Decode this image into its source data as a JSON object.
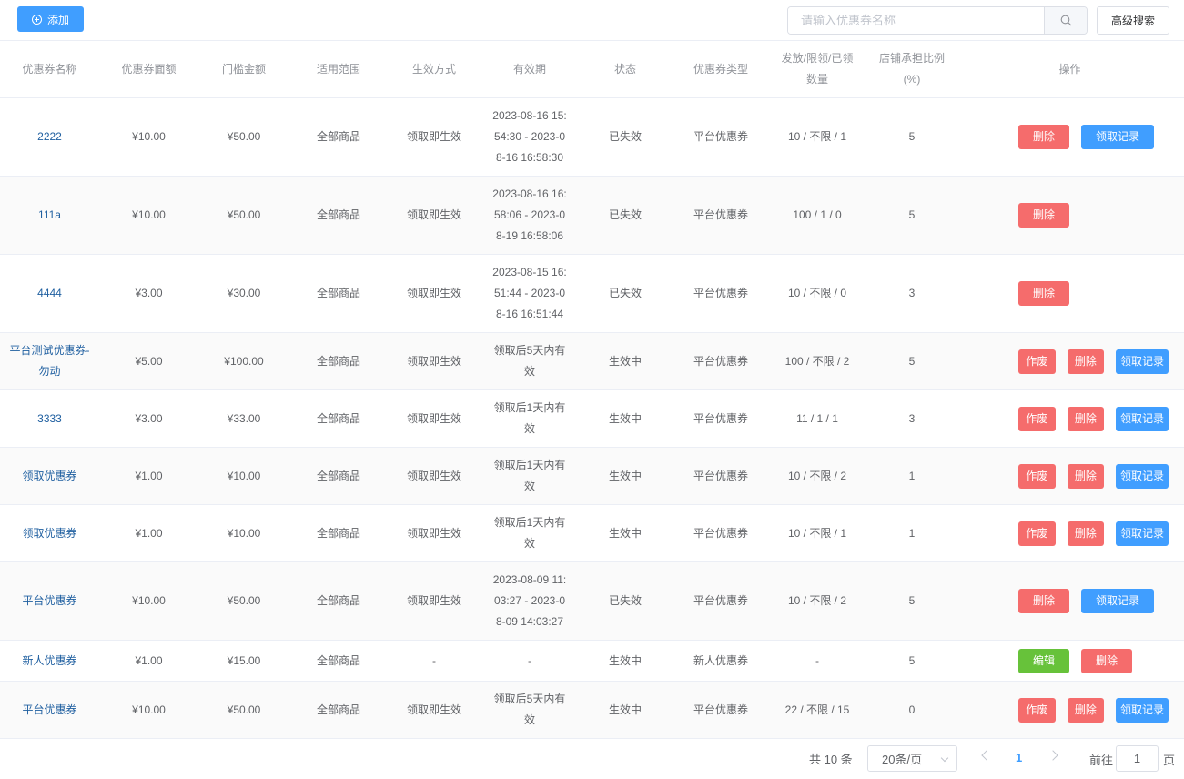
{
  "toolbar": {
    "add_label": "添加",
    "search_placeholder": "请输入优惠券名称",
    "advanced_search_label": "高级搜索"
  },
  "table": {
    "headers": {
      "name": "优惠券名称",
      "amount": "优惠券面额",
      "threshold": "门槛金额",
      "scope": "适用范围",
      "effect_mode": "生效方式",
      "validity": "有效期",
      "status": "状态",
      "type": "优惠券类型",
      "quantity_l1": "发放/限领/已领",
      "quantity_l2": "数量",
      "ratio_l1": "店铺承担比例",
      "ratio_l2": "(%)",
      "ops": "操作"
    },
    "rows": [
      {
        "name": "2222",
        "amount": "¥10.00",
        "threshold": "¥50.00",
        "scope": "全部商品",
        "effect_mode": "领取即生效",
        "validity": [
          "2023-08-16 15:",
          "54:30 - 2023-0",
          "8-16 16:58:30"
        ],
        "status": "已失效",
        "type": "平台优惠券",
        "quantity": "10 / 不限 / 1",
        "ratio": "5",
        "ops": [
          {
            "label": "删除",
            "kind": "red"
          },
          {
            "label": "领取记录",
            "kind": "blue"
          }
        ]
      },
      {
        "name": "111a",
        "amount": "¥10.00",
        "threshold": "¥50.00",
        "scope": "全部商品",
        "effect_mode": "领取即生效",
        "validity": [
          "2023-08-16 16:",
          "58:06 - 2023-0",
          "8-19 16:58:06"
        ],
        "status": "已失效",
        "type": "平台优惠券",
        "quantity": "100 / 1 / 0",
        "ratio": "5",
        "ops": [
          {
            "label": "删除",
            "kind": "red"
          }
        ]
      },
      {
        "name": "4444",
        "amount": "¥3.00",
        "threshold": "¥30.00",
        "scope": "全部商品",
        "effect_mode": "领取即生效",
        "validity": [
          "2023-08-15 16:",
          "51:44 - 2023-0",
          "8-16 16:51:44"
        ],
        "status": "已失效",
        "type": "平台优惠券",
        "quantity": "10 / 不限 / 0",
        "ratio": "3",
        "ops": [
          {
            "label": "删除",
            "kind": "red"
          }
        ]
      },
      {
        "name": [
          "平台测试优惠券-",
          "勿动"
        ],
        "amount": "¥5.00",
        "threshold": "¥100.00",
        "scope": "全部商品",
        "effect_mode": "领取即生效",
        "validity": [
          "领取后5天内有",
          "效"
        ],
        "status": "生效中",
        "type": "平台优惠券",
        "quantity": "100 / 不限 / 2",
        "ratio": "5",
        "ops": [
          {
            "label": "作废",
            "kind": "red"
          },
          {
            "label": "删除",
            "kind": "red"
          },
          {
            "label": "领取记录",
            "kind": "blue"
          }
        ]
      },
      {
        "name": "3333",
        "amount": "¥3.00",
        "threshold": "¥33.00",
        "scope": "全部商品",
        "effect_mode": "领取即生效",
        "validity": [
          "领取后1天内有",
          "效"
        ],
        "status": "生效中",
        "type": "平台优惠券",
        "quantity": "11 / 1 / 1",
        "ratio": "3",
        "ops": [
          {
            "label": "作废",
            "kind": "red"
          },
          {
            "label": "删除",
            "kind": "red"
          },
          {
            "label": "领取记录",
            "kind": "blue"
          }
        ]
      },
      {
        "name": "领取优惠券",
        "amount": "¥1.00",
        "threshold": "¥10.00",
        "scope": "全部商品",
        "effect_mode": "领取即生效",
        "validity": [
          "领取后1天内有",
          "效"
        ],
        "status": "生效中",
        "type": "平台优惠券",
        "quantity": "10 / 不限 / 2",
        "ratio": "1",
        "ops": [
          {
            "label": "作废",
            "kind": "red"
          },
          {
            "label": "删除",
            "kind": "red"
          },
          {
            "label": "领取记录",
            "kind": "blue"
          }
        ]
      },
      {
        "name": "领取优惠券",
        "amount": "¥1.00",
        "threshold": "¥10.00",
        "scope": "全部商品",
        "effect_mode": "领取即生效",
        "validity": [
          "领取后1天内有",
          "效"
        ],
        "status": "生效中",
        "type": "平台优惠券",
        "quantity": "10 / 不限 / 1",
        "ratio": "1",
        "ops": [
          {
            "label": "作废",
            "kind": "red"
          },
          {
            "label": "删除",
            "kind": "red"
          },
          {
            "label": "领取记录",
            "kind": "blue"
          }
        ]
      },
      {
        "name": "平台优惠券",
        "amount": "¥10.00",
        "threshold": "¥50.00",
        "scope": "全部商品",
        "effect_mode": "领取即生效",
        "validity": [
          "2023-08-09 11:",
          "03:27 - 2023-0",
          "8-09 14:03:27"
        ],
        "status": "已失效",
        "type": "平台优惠券",
        "quantity": "10 / 不限 / 2",
        "ratio": "5",
        "ops": [
          {
            "label": "删除",
            "kind": "red"
          },
          {
            "label": "领取记录",
            "kind": "blue"
          }
        ]
      },
      {
        "name": "新人优惠券",
        "amount": "¥1.00",
        "threshold": "¥15.00",
        "scope": "全部商品",
        "effect_mode": "-",
        "validity": [
          "-"
        ],
        "status": "生效中",
        "type": "新人优惠券",
        "quantity": "-",
        "ratio": "5",
        "ops": [
          {
            "label": "编辑",
            "kind": "green"
          },
          {
            "label": "删除",
            "kind": "red"
          }
        ]
      },
      {
        "name": "平台优惠券",
        "amount": "¥10.00",
        "threshold": "¥50.00",
        "scope": "全部商品",
        "effect_mode": "领取即生效",
        "validity": [
          "领取后5天内有",
          "效"
        ],
        "status": "生效中",
        "type": "平台优惠券",
        "quantity": "22 / 不限 / 15",
        "ratio": "0",
        "ops": [
          {
            "label": "作废",
            "kind": "red"
          },
          {
            "label": "删除",
            "kind": "red"
          },
          {
            "label": "领取记录",
            "kind": "blue"
          }
        ]
      }
    ]
  },
  "pagination": {
    "total_label": "共 10 条",
    "page_size": "20条/页",
    "current_page": "1",
    "goto_label": "前往",
    "goto_value": "1",
    "page_unit": "页"
  },
  "colors": {
    "primary": "#409eff",
    "danger": "#f56c6c",
    "success": "#67c23a",
    "link": "#1f5fa0"
  },
  "icons": [
    "plus-circle-icon",
    "search-icon",
    "chevron-down-icon",
    "chevron-left-icon",
    "chevron-right-icon"
  ]
}
